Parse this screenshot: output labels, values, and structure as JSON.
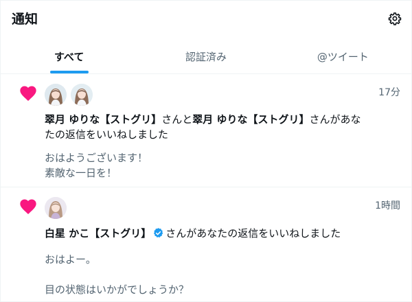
{
  "header": {
    "title": "通知",
    "settings_icon": "gear-icon"
  },
  "tabs": [
    {
      "label": "すべて",
      "active": true
    },
    {
      "label": "認証済み",
      "active": false
    },
    {
      "label": "@ツイート",
      "active": false
    }
  ],
  "accent_color": "#1d9bf0",
  "like_color": "#f91880",
  "notifications": [
    {
      "icon": "heart-icon",
      "avatars": [
        "avatar-user-1",
        "avatar-user-2"
      ],
      "time": "17分",
      "user1": "翠月 ゆりな【ストグリ】",
      "connector": "さんと",
      "user2": "翠月 ゆりな【ストグリ】",
      "action": "さんがあなたの返信をいいねしました",
      "reply_text": "おはようございます！\n素敵な一日を！"
    },
    {
      "icon": "heart-icon",
      "avatars": [
        "avatar-user-3"
      ],
      "time": "1時間",
      "user1": "白星 かこ【ストグリ】",
      "verified": true,
      "action": "さんがあなたの返信をいいねしました",
      "reply_text": "おはよー。\n\n目の状態はいかがでしょうか？"
    }
  ]
}
